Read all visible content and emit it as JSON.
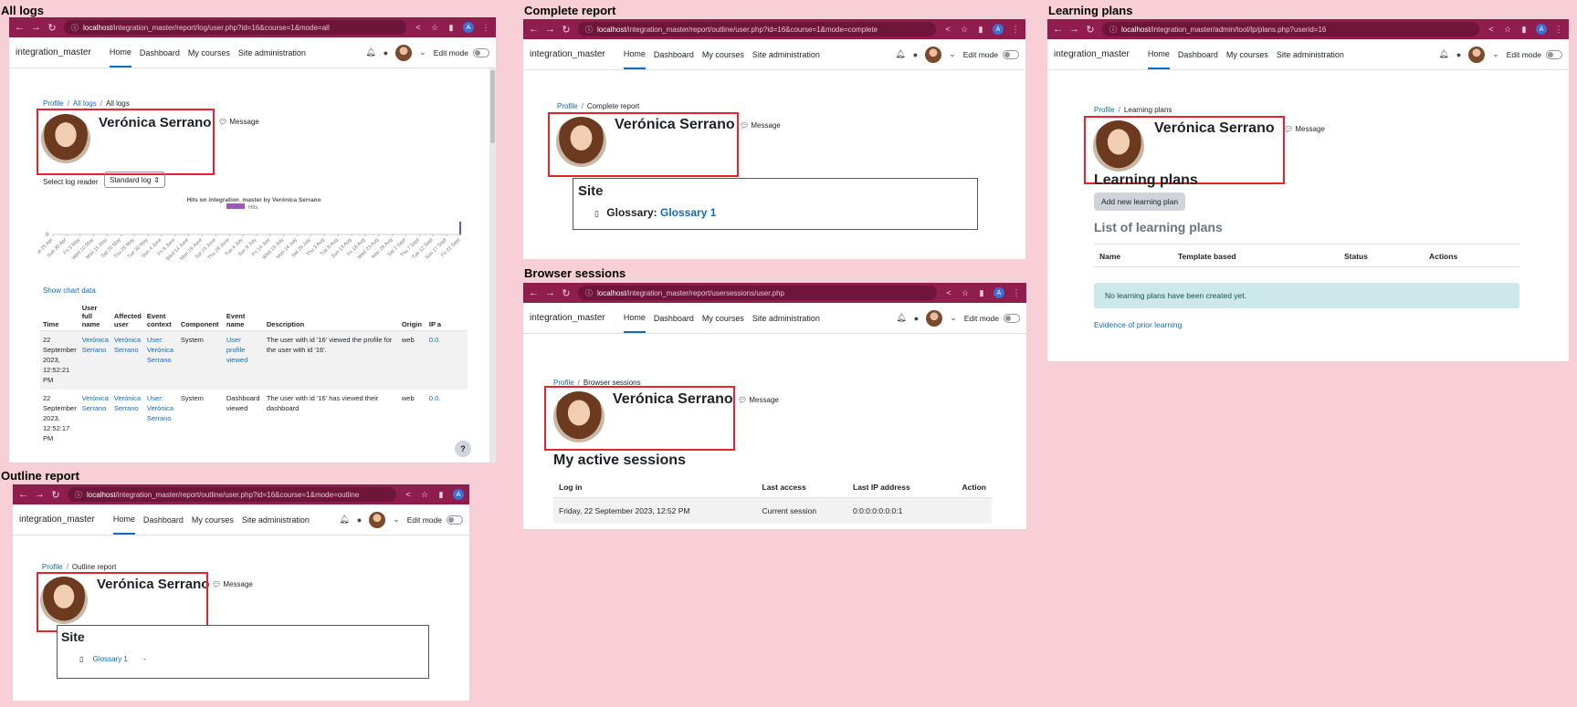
{
  "browser": {
    "lock_icon": "lock-icon",
    "colors": {
      "chrome": "#8f1d4e",
      "accent": "#0f6cbf",
      "highlight": "#e8232f"
    }
  },
  "common": {
    "site_name": "integration_master",
    "nav": [
      "Home",
      "Dashboard",
      "My courses",
      "Site administration"
    ],
    "edit_mode": "Edit mode",
    "profile_name": "Verónica Serrano",
    "message": "Message",
    "breadcrumb_profile": "Profile",
    "help": "?"
  },
  "panels": {
    "all_logs": {
      "title": "All logs",
      "url_host": "localhost",
      "url_path": "/integration_master/report/log/user.php?id=16&course=1&mode=all",
      "breadcrumb_mid": "All logs",
      "breadcrumb_last": "All logs",
      "select_label": "Select log reader",
      "select_value": "Standard log",
      "chart_title": "Hits on integration_master by Verónica Serrano",
      "show_chart_data": "Show chart data",
      "table": {
        "headers": [
          "Time",
          "User full name",
          "Affected user",
          "Event context",
          "Component",
          "Event name",
          "Description",
          "Origin",
          "IP a"
        ],
        "rows": [
          [
            "22 September 2023, 12:52:21 PM",
            "Verónica Serrano",
            "Verónica Serrano",
            "User: Verónica Serrano",
            "System",
            "User profile viewed",
            "The user with id '16' viewed the profile for the user with id '16'.",
            "web",
            "0.0."
          ],
          [
            "22 September 2023, 12:52:17 PM",
            "Verónica Serrano",
            "Verónica Serrano",
            "User: Verónica Serrano",
            "System",
            "Dashboard viewed",
            "The user with id '16' has viewed their dashboard",
            "web",
            "0.0."
          ]
        ]
      }
    },
    "outline_report": {
      "title": "Outline report",
      "url_host": "localhost",
      "url_path": "/integration_master/report/outline/user.php?id=16&course=1&mode=outline",
      "breadcrumb_last": "Outline report",
      "site_heading": "Site",
      "item_link": "Glossary 1",
      "item_value": "-"
    },
    "complete_report": {
      "title": "Complete report",
      "url_host": "localhost",
      "url_path": "/integration_master/report/outline/user.php?id=16&course=1&mode=complete",
      "breadcrumb_last": "Complete report",
      "site_heading": "Site",
      "item_prefix": "Glossary:",
      "item_link": "Glossary 1"
    },
    "browser_sessions": {
      "title": "Browser sessions",
      "url_host": "localhost",
      "url_path": "/integration_master/report/usersessions/user.php",
      "breadcrumb_last": "Browser sessions",
      "heading": "My active sessions",
      "headers": [
        "Log in",
        "Last access",
        "Last IP address",
        "Action"
      ],
      "row": [
        "Friday, 22 September 2023, 12:52 PM",
        "Current session",
        "0:0:0:0:0:0:0:1",
        ""
      ]
    },
    "learning_plans": {
      "title": "Learning plans",
      "url_host": "localhost",
      "url_path": "/integration_master/admin/tool/lp/plans.php?userid=16",
      "breadcrumb_last": "Learning plans",
      "heading": "Learning plans",
      "add_button": "Add new learning plan",
      "list_heading": "List of learning plans",
      "headers": [
        "Name",
        "Template based",
        "Status",
        "Actions"
      ],
      "empty_notice": "No learning plans have been created yet.",
      "evidence_link": "Evidence of prior learning"
    }
  },
  "chart_data": {
    "type": "bar",
    "title": "Hits on integration_master by Verónica Serrano",
    "series": [
      {
        "name": "Hits",
        "values": [
          0,
          0,
          0,
          0,
          0,
          0,
          0,
          0,
          0,
          0,
          0,
          0,
          0,
          0,
          0,
          0,
          0,
          0,
          0,
          0,
          0,
          0,
          0,
          0,
          0,
          0,
          0,
          0,
          0,
          0,
          0,
          0,
          0,
          0,
          0,
          0,
          0,
          0,
          0,
          0,
          0,
          0,
          0,
          0,
          0,
          0,
          0,
          0,
          0,
          0,
          0,
          0,
          0,
          0,
          0,
          0,
          0,
          0,
          0,
          0,
          0,
          0,
          0,
          0,
          0,
          0,
          0,
          0,
          0,
          0,
          0,
          0,
          0,
          0,
          0,
          0,
          0,
          0,
          0,
          0,
          0,
          0,
          0,
          0,
          0,
          0,
          0,
          0,
          0,
          0,
          0,
          0,
          0,
          0,
          0,
          0,
          0,
          0,
          0,
          0,
          0,
          0,
          0,
          0,
          0,
          0,
          0,
          0,
          0,
          0,
          0,
          0,
          0,
          0,
          0,
          0,
          0,
          0,
          0,
          0,
          0,
          0,
          0,
          0,
          0,
          0,
          0,
          0,
          0,
          0,
          0,
          0,
          0,
          0,
          0,
          0,
          0,
          0,
          0,
          0,
          0,
          0,
          0,
          0,
          0,
          0,
          0,
          0,
          0,
          0,
          0,
          0,
          0,
          0,
          0,
          0,
          0,
          0,
          2
        ]
      }
    ],
    "categories": [
      "Tue 25 Apr",
      "Sun 30 Apr",
      "Fri 5 May",
      "Wed 10 May",
      "Mon 15 May",
      "Sat 20 May",
      "Thu 25 May",
      "Tue 30 May",
      "Sun 4 June",
      "Fri 9 June",
      "Wed 14 June",
      "Mon 19 June",
      "Sat 24 June",
      "Thu 29 June",
      "Tue 4 July",
      "Sun 9 July",
      "Fri 14 July",
      "Wed 19 July",
      "Mon 24 July",
      "Sat 29 July",
      "Thu 3 Aug",
      "Tue 8 Aug",
      "Sun 13 Aug",
      "Fri 18 Aug",
      "Wed 23 Aug",
      "Mon 28 Aug",
      "Sat 2 Sept",
      "Thu 7 Sept",
      "Tue 12 Sept",
      "Sun 17 Sept",
      "Fri 22 Sept"
    ],
    "ylim": [
      0,
      2
    ],
    "yticks": [
      0
    ],
    "legend": "top"
  }
}
